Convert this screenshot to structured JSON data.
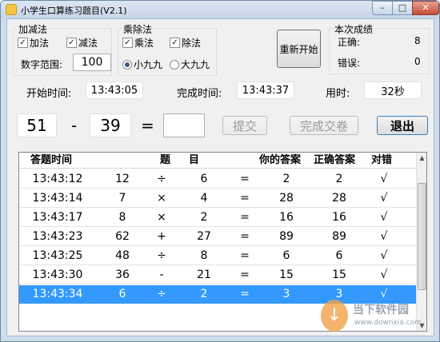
{
  "window": {
    "title": "小学生口算练习题目(V2.1)",
    "controls": {
      "minimize": "–",
      "maximize": "□",
      "close": "✕"
    }
  },
  "add_sub_group": {
    "title": "加减法",
    "add_label": "加法",
    "add_checked": true,
    "sub_label": "减法",
    "sub_checked": true,
    "range_label": "数字范围:",
    "range_value": "100"
  },
  "mul_div_group": {
    "title": "乘除法",
    "mul_label": "乘法",
    "mul_checked": true,
    "div_label": "除法",
    "div_checked": true,
    "small_table_label": "小九九",
    "big_table_label": "大九九",
    "selected_table": "小九九"
  },
  "restart_button": "重新开始",
  "score_group": {
    "title": "本次成绩",
    "correct_label": "正确:",
    "correct_value": "8",
    "wrong_label": "错误:",
    "wrong_value": "0"
  },
  "timing": {
    "start_label": "开始时间:",
    "start_value": "13:43:05",
    "finish_label": "完成时间:",
    "finish_value": "13:43:37",
    "elapsed_label": "用时:",
    "elapsed_value": "32秒"
  },
  "question": {
    "operand_a": "51",
    "operator": "-",
    "operand_b": "39",
    "equals": "=",
    "answer_value": ""
  },
  "buttons": {
    "submit": "提交",
    "finish": "完成交卷",
    "exit": "退出"
  },
  "table": {
    "columns": [
      "答题时间",
      "题",
      "目",
      "你的答案",
      "正确答案",
      "对错"
    ],
    "rows": [
      {
        "time": "13:43:12",
        "a": "12",
        "op": "÷",
        "b": "6",
        "eq": "=",
        "answer": "2",
        "correct": "2",
        "ok": "√"
      },
      {
        "time": "13:43:14",
        "a": "7",
        "op": "×",
        "b": "4",
        "eq": "=",
        "answer": "28",
        "correct": "28",
        "ok": "√"
      },
      {
        "time": "13:43:17",
        "a": "8",
        "op": "×",
        "b": "2",
        "eq": "=",
        "answer": "16",
        "correct": "16",
        "ok": "√"
      },
      {
        "time": "13:43:23",
        "a": "62",
        "op": "+",
        "b": "27",
        "eq": "=",
        "answer": "89",
        "correct": "89",
        "ok": "√"
      },
      {
        "time": "13:43:25",
        "a": "48",
        "op": "÷",
        "b": "8",
        "eq": "=",
        "answer": "6",
        "correct": "6",
        "ok": "√"
      },
      {
        "time": "13:43:30",
        "a": "36",
        "op": "-",
        "b": "21",
        "eq": "=",
        "answer": "15",
        "correct": "15",
        "ok": "√"
      },
      {
        "time": "13:43:34",
        "a": "6",
        "op": "÷",
        "b": "2",
        "eq": "=",
        "answer": "3",
        "correct": "3",
        "ok": "√"
      }
    ],
    "selected_row": 6
  },
  "watermark": {
    "text": "当下软件园",
    "url": "www.downxia.com"
  },
  "colors": {
    "selection": "#3399ff",
    "title_bar": "#c6d5e8"
  },
  "icons": {
    "app": "app-icon",
    "check": "check-mark-icon",
    "radio": "radio-dot-icon"
  }
}
